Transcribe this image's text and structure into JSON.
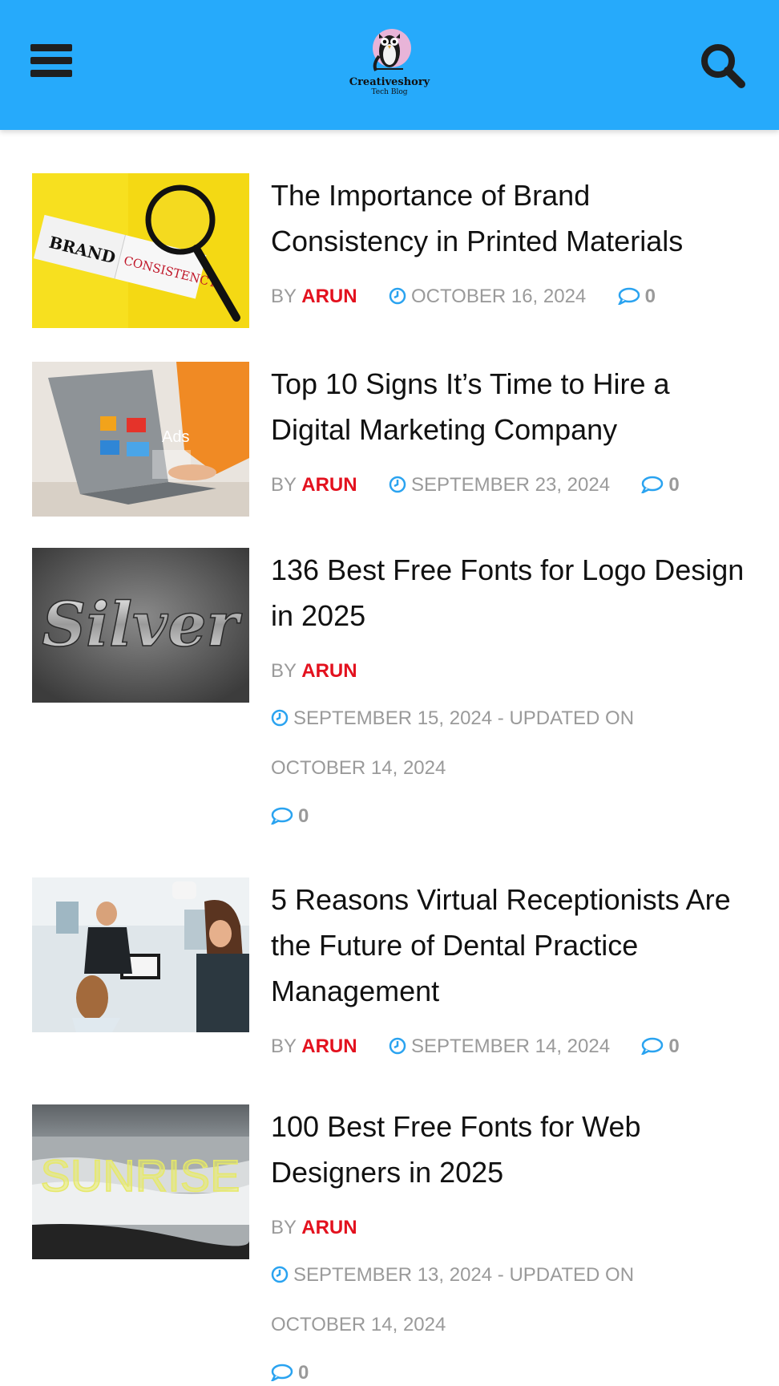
{
  "header": {
    "logo_name": "Creativeshory",
    "logo_tag": "Tech Blog"
  },
  "colors": {
    "header_bg": "#26aafb",
    "author": "#e3111e",
    "meta": "#9a9a9a",
    "icon_accent": "#2aa3f0"
  },
  "icons": {
    "menu": "hamburger-icon",
    "search": "search-icon",
    "clock": "clock-icon",
    "comment": "comment-icon"
  },
  "articles": [
    {
      "title": "The Importance of Brand Consistency in Printed Materials",
      "by": "BY",
      "author": "ARUN",
      "date": "OCTOBER 16, 2024",
      "comments": "0",
      "image_text_1": "BRAND",
      "image_text_2": "CONSISTENCY"
    },
    {
      "title": "Top 10 Signs It’s Time to Hire a Digital Marketing Company",
      "by": "BY",
      "author": "ARUN",
      "date": "SEPTEMBER 23, 2024",
      "comments": "0",
      "image_text_1": "Ads"
    },
    {
      "title": "136 Best Free Fonts for Logo Design in 2025",
      "by": "BY",
      "author": "ARUN",
      "date": "SEPTEMBER 15, 2024",
      "updated_label": "- UPDATED ON",
      "updated": "OCTOBER 14, 2024",
      "comments": "0",
      "image_text_1": "Silver"
    },
    {
      "title": "5 Reasons Virtual Receptionists Are the Future of Dental Practice Management",
      "by": "BY",
      "author": "ARUN",
      "date": "SEPTEMBER 14, 2024",
      "comments": "0"
    },
    {
      "title": "100 Best Free Fonts for Web Designers in 2025",
      "by": "BY",
      "author": "ARUN",
      "date": "SEPTEMBER 13, 2024",
      "updated_label": "- UPDATED ON",
      "updated": "OCTOBER 14, 2024",
      "comments": "0",
      "image_text_1": "SUNRISE"
    }
  ]
}
